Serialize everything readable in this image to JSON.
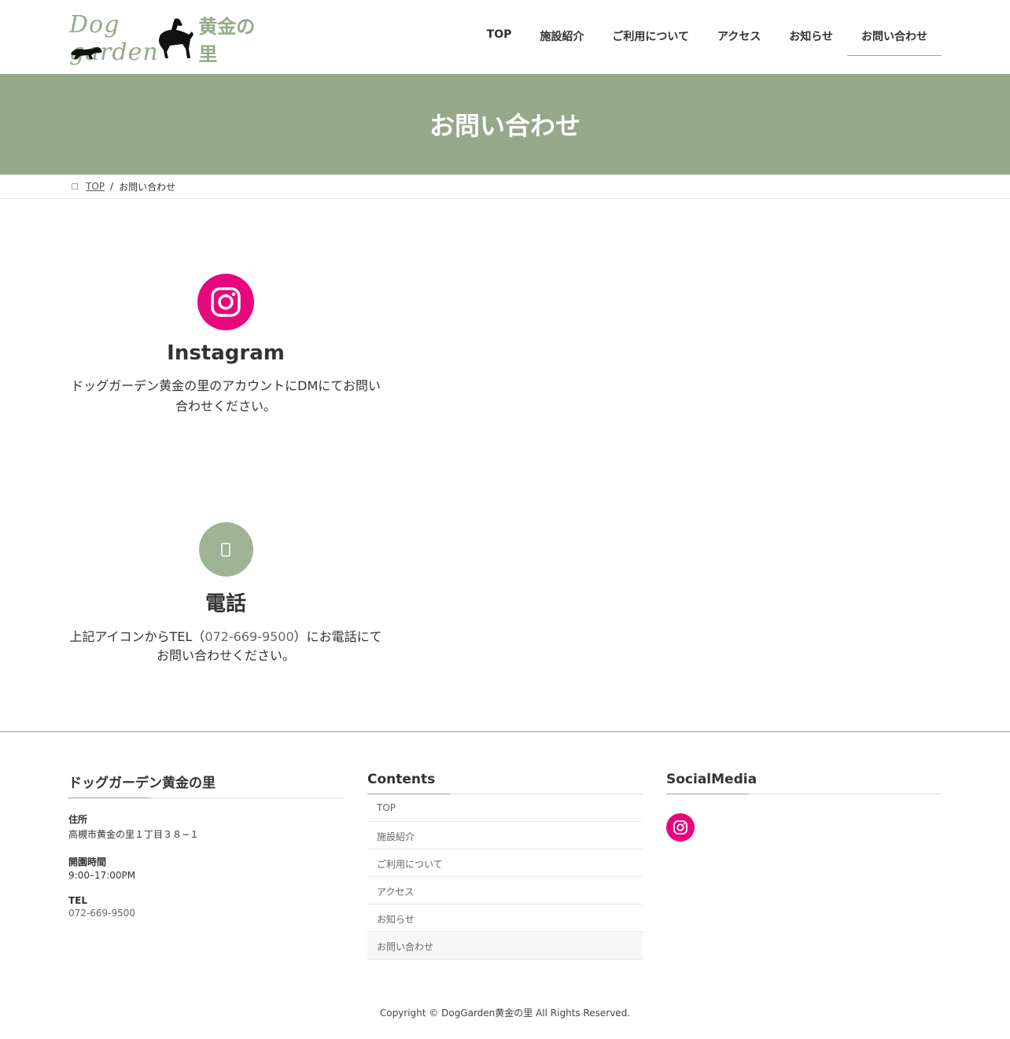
{
  "header": {
    "logo_script": "Dog garden",
    "logo_jp": "黄金の里",
    "nav": [
      "TOP",
      "施設紹介",
      "ご利用について",
      "アクセス",
      "お知らせ",
      "お問い合わせ"
    ]
  },
  "hero": {
    "title": "お問い合わせ"
  },
  "breadcrumb": {
    "home": "TOP",
    "separator": "/",
    "current": "お問い合わせ"
  },
  "contacts": {
    "instagram": {
      "icon": "instagram-icon",
      "title": "Instagram",
      "text": "ドッグガーデン黄金の里のアカウントにDMにてお問い合わせください。"
    },
    "phone": {
      "icon": "phone-icon",
      "title": "電話",
      "text_before": "上記アイコンからTEL（",
      "tel": "072-669-9500",
      "text_after": "）にお電話にてお問い合わせください。"
    }
  },
  "footer": {
    "info_title": "ドッグガーデン黄金の里",
    "address_label": "住所",
    "address": "高槻市黄金の里１丁目３８−１",
    "hours_label": "開園時間",
    "hours": "9:00–17:00PM",
    "tel_label": "TEL",
    "tel": "072-669-9500",
    "contents_title": "Contents",
    "contents": [
      "TOP",
      "施設紹介",
      "ご利用について",
      "アクセス",
      "お知らせ",
      "お問い合わせ"
    ],
    "social_title": "SocialMedia",
    "copyright": "Copyright © DogGarden黄金の里 All Rights Reserved."
  },
  "colors": {
    "accent": "#95a889",
    "instagram": "#e8067c",
    "text": "#333333"
  }
}
